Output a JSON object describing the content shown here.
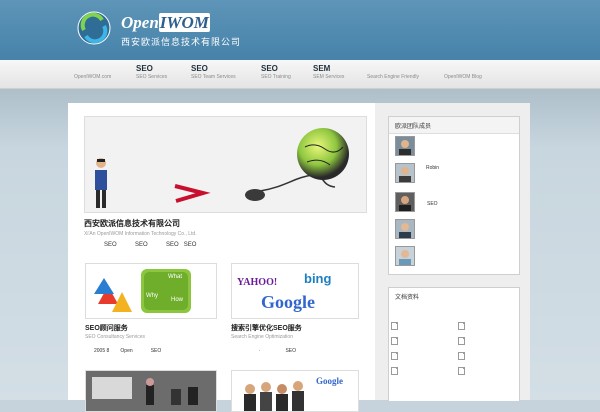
{
  "header": {
    "brand": {
      "prefix": "Open",
      "highlight": "IWOM"
    },
    "company": "西安欧派信息技术有限公司"
  },
  "nav": [
    {
      "title": "",
      "sub": "OpenIWOM.com"
    },
    {
      "title": "SEO",
      "sub": "SEO Services"
    },
    {
      "title": "SEO",
      "sub": "SEO Team Services"
    },
    {
      "title": "SEO",
      "sub": "SEO Training"
    },
    {
      "title": "SEM",
      "sub": "SEM Services"
    },
    {
      "title": "",
      "sub": "Search Engine Friendly"
    },
    {
      "title": "",
      "sub": "OpenIWOM Blog"
    }
  ],
  "main": {
    "intro": {
      "title": "西安欧派信息技术有限公司",
      "subtitle": "Xi'An OpenIWOM Information Technology Co., Ltd.",
      "tags": "SEO           SEO           SEO   SEO"
    },
    "card1": {
      "title": "SEO顾问服务",
      "subtitle": "SEO Consultancy Services",
      "meta": "2005 8        Open             SEO",
      "thumb_labels": [
        "What",
        "Why",
        "How"
      ]
    },
    "card2": {
      "title": "搜索引擎优化SEO服务",
      "subtitle": "Search Engine Optimization",
      "meta": "                    ·                  SEO",
      "thumb_logos": [
        "YAHOO!",
        "bing",
        "Google"
      ]
    },
    "card4": {
      "thumb_logo": "Google"
    }
  },
  "sidebar": {
    "team": {
      "heading": "欧派团队成员",
      "members": [
        {
          "name": ""
        },
        {
          "name": "Robin"
        },
        {
          "name": ""
        },
        {
          "name": "SEO"
        },
        {
          "name": ""
        },
        {
          "name": ""
        }
      ]
    },
    "docs": {
      "heading": "文档资料"
    }
  },
  "colors": {
    "header_blue": "#4f8ab0",
    "accent_red": "#c8102e",
    "globe_green": "#9acd32"
  }
}
